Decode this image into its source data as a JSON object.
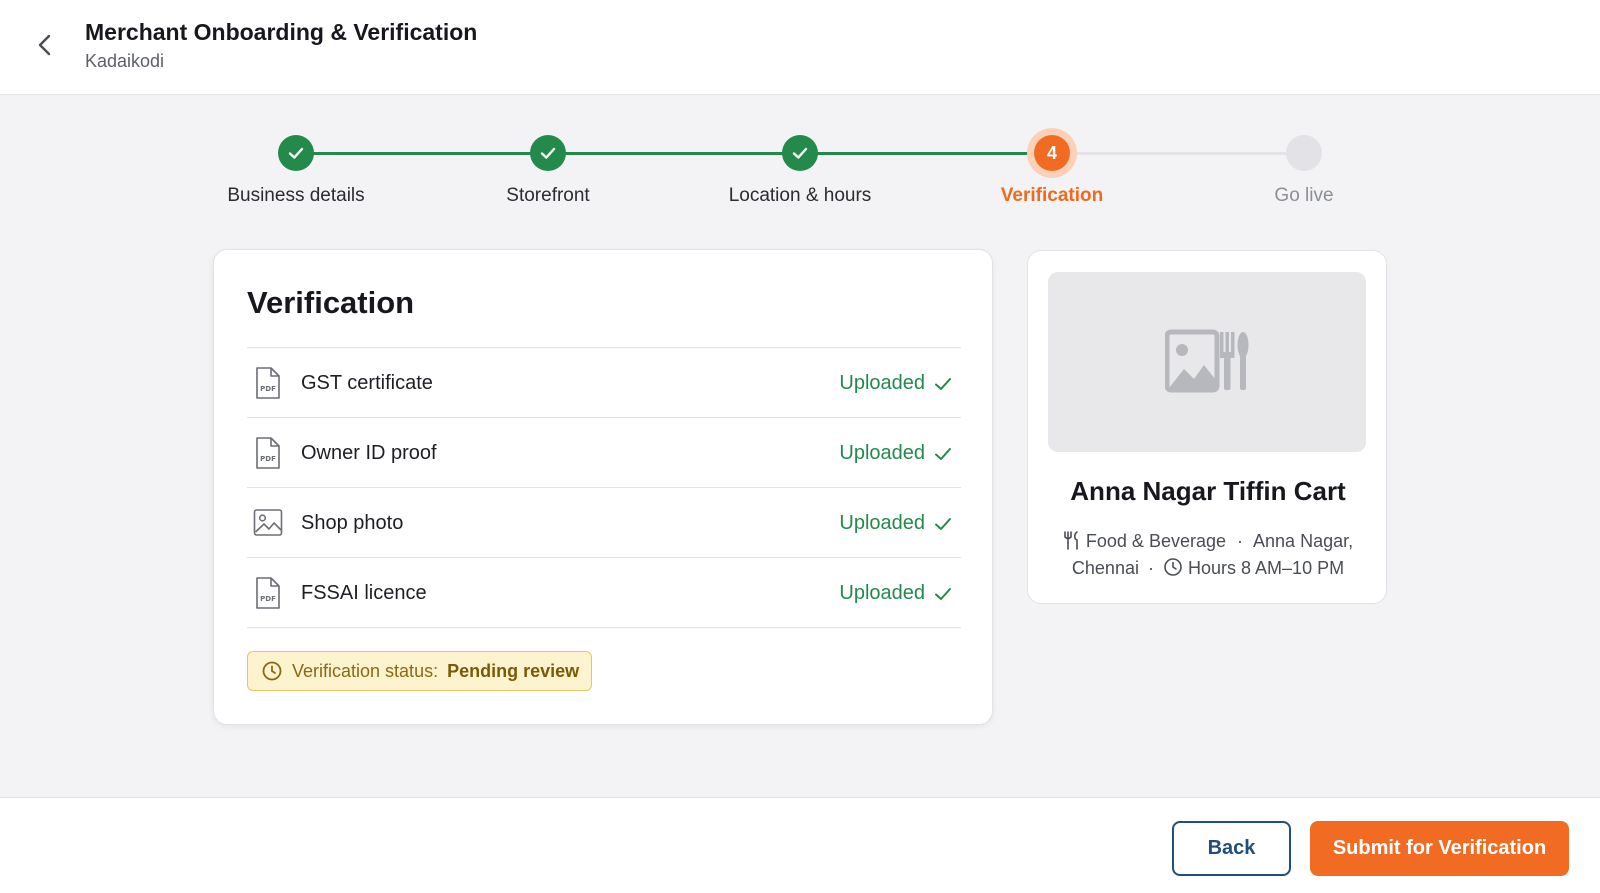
{
  "header": {
    "title": "Merchant Onboarding & Verification",
    "subtitle": "Kadaikodi"
  },
  "steps": [
    {
      "label": "Business details",
      "state": "done"
    },
    {
      "label": "Storefront",
      "state": "done"
    },
    {
      "label": "Location & hours",
      "state": "done"
    },
    {
      "label": "Verification",
      "state": "current",
      "number": "4"
    },
    {
      "label": "Go live",
      "state": "todo"
    }
  ],
  "verification": {
    "title": "Verification",
    "documents": [
      {
        "name": "GST certificate",
        "status": "Uploaded",
        "icon": "pdf-file-icon"
      },
      {
        "name": "Owner ID proof",
        "status": "Uploaded",
        "icon": "pdf-file-icon"
      },
      {
        "name": "Shop photo",
        "status": "Uploaded",
        "icon": "image-icon"
      },
      {
        "name": "FSSAI licence",
        "status": "Uploaded",
        "icon": "pdf-file-icon"
      }
    ],
    "status_label": "Verification status:",
    "status_value": "Pending review"
  },
  "preview": {
    "name": "Anna Nagar Tiffin Cart",
    "category": "Food & Beverage",
    "location": "Anna Nagar, Chennai",
    "hours": "Hours 8 AM–10 PM",
    "separator": "·"
  },
  "footer": {
    "back_label": "Back",
    "submit_label": "Submit for Verification"
  },
  "colors": {
    "accent": "#f26b22",
    "success": "#238a4c",
    "warning_bg": "#fdf3cf",
    "primary_outline": "#1f4f7a"
  }
}
